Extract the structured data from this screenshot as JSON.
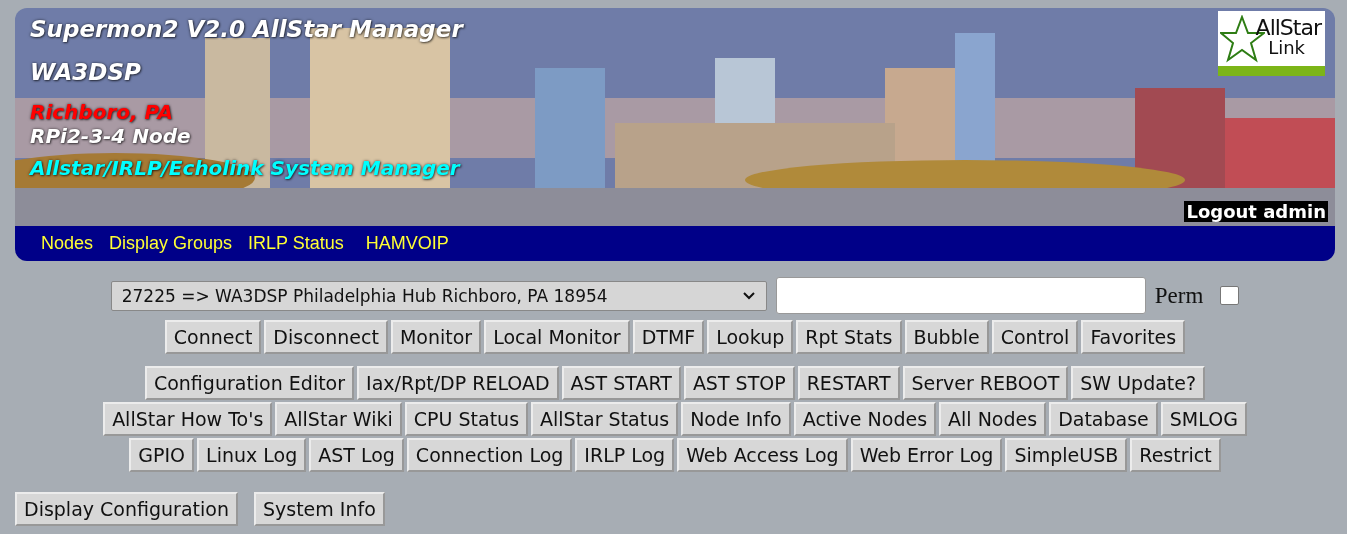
{
  "header": {
    "title": "Supermon2 V2.0 AllStar Manager",
    "callsign": "WA3DSP",
    "location": "Richboro, PA",
    "node_type": "RPi2-3-4 Node",
    "subtitle": "Allstar/IRLP/Echolink System Manager",
    "logo": {
      "line_1": "AllStar",
      "line_2": "Link"
    },
    "logout": "Logout admin"
  },
  "nav": [
    "Nodes",
    "Display Groups",
    "IRLP Status",
    "HAMVOIP"
  ],
  "node_select": {
    "value": "27225 => WA3DSP Philadelphia Hub Richboro, PA 18954"
  },
  "perm": {
    "label": "Perm",
    "checked": false
  },
  "button_rows": [
    [
      "Connect",
      "Disconnect",
      "Monitor",
      "Local Monitor",
      "DTMF",
      "Lookup",
      "Rpt Stats",
      "Bubble",
      "Control",
      "Favorites"
    ],
    [
      "Configuration Editor",
      "Iax/Rpt/DP RELOAD",
      "AST START",
      "AST STOP",
      "RESTART",
      "Server REBOOT",
      "SW Update?"
    ],
    [
      "AllStar How To's",
      "AllStar Wiki",
      "CPU Status",
      "AllStar Status",
      "Node Info",
      "Active Nodes",
      "All Nodes",
      "Database",
      "SMLOG"
    ],
    [
      "GPIO",
      "Linux Log",
      "AST Log",
      "Connection Log",
      "IRLP Log",
      "Web Access Log",
      "Web Error Log",
      "SimpleUSB",
      "Restrict"
    ]
  ],
  "footer_buttons": [
    "Display Configuration",
    "System Info"
  ]
}
